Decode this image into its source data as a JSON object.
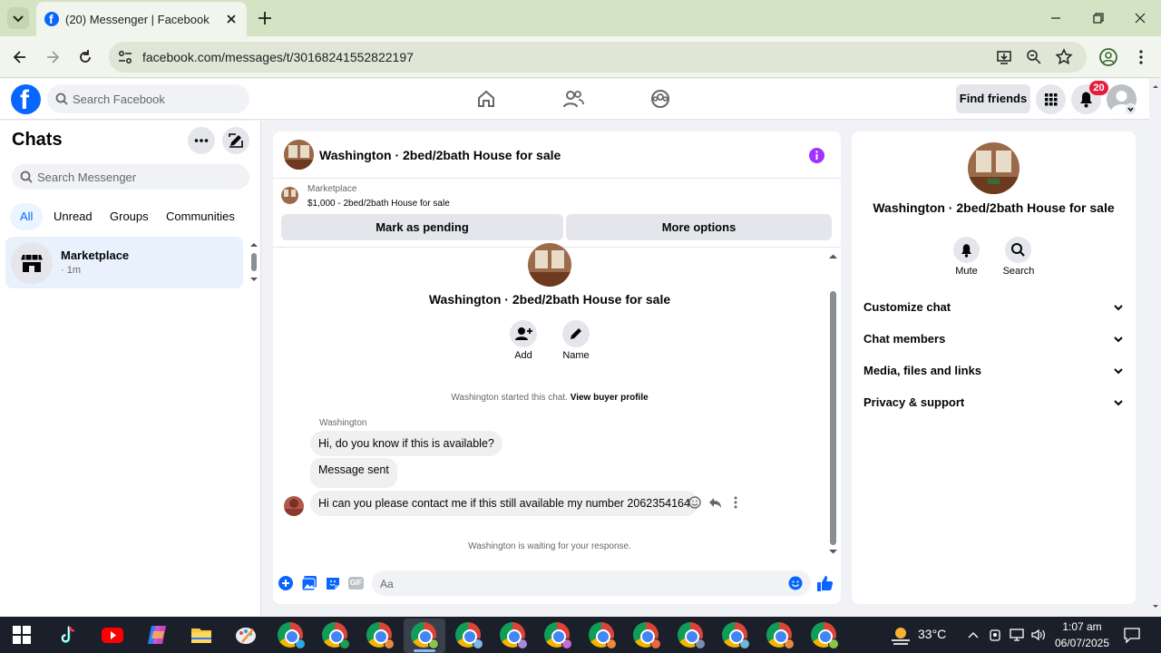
{
  "browser": {
    "tab_title": "(20) Messenger | Facebook",
    "url": "facebook.com/messages/t/30168241552822197"
  },
  "fb_header": {
    "search_placeholder": "Search Facebook",
    "find_friends": "Find friends",
    "notif_count": "20"
  },
  "chats": {
    "title": "Chats",
    "search_placeholder": "Search Messenger",
    "filters": [
      "All",
      "Unread",
      "Groups",
      "Communities"
    ],
    "items": [
      {
        "name": "Marketplace",
        "time": "· 1m"
      }
    ]
  },
  "conversation": {
    "title": "Washington · 2bed/2bath House for sale",
    "listing_source": "Marketplace",
    "listing_desc": "$1,000 - 2bed/2bath House for sale",
    "mark_pending": "Mark as pending",
    "more_options": "More options",
    "intro_title": "Washington · 2bed/2bath House for sale",
    "add_label": "Add",
    "name_label": "Name",
    "started_text": "Washington started this chat.",
    "view_buyer": "View buyer profile",
    "sender": "Washington",
    "messages": [
      "Hi, do you know if this is available?",
      "Message sent",
      "Hi can you please contact me if this still available my number 2062354164"
    ],
    "waiting_text": "Washington is waiting for your response.",
    "composer_placeholder": "Aa"
  },
  "info_panel": {
    "title": "Washington · 2bed/2bath House for sale",
    "mute": "Mute",
    "search": "Search",
    "sections": [
      "Customize chat",
      "Chat members",
      "Media, files and links",
      "Privacy & support"
    ]
  },
  "taskbar": {
    "temperature": "33°C",
    "time": "1:07 am",
    "date": "06/07/2025"
  },
  "colors": {
    "brand_blue": "#0866ff",
    "notif_red": "#e41e3f",
    "info_purple": "#a033ff"
  }
}
